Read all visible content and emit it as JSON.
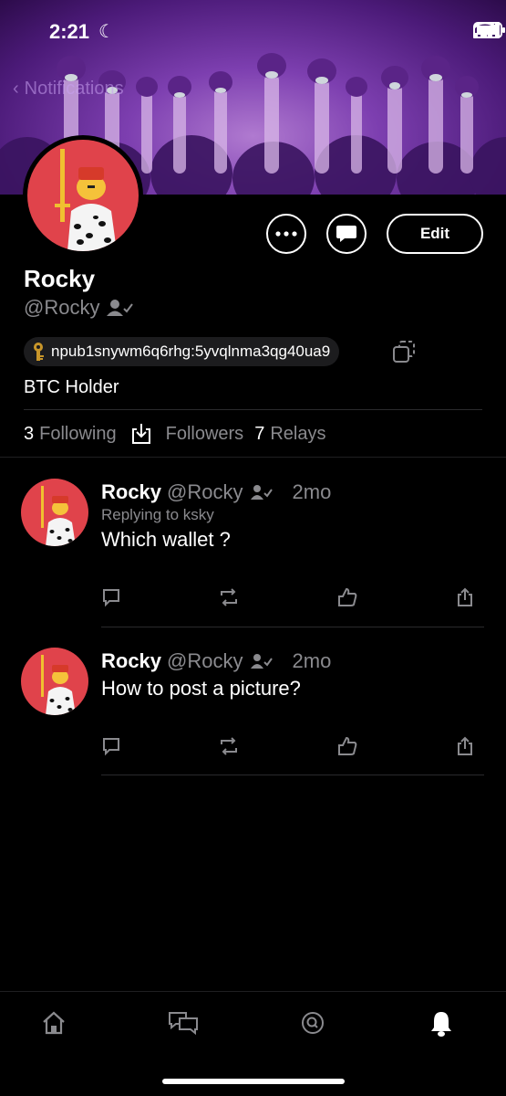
{
  "status": {
    "time": "2:21"
  },
  "header": {
    "back_label": "Notifications"
  },
  "profile": {
    "name": "Rocky",
    "handle": "@Rocky",
    "npub": "npub1snywm6q6rhg:5yvqlnma3qg40ua9",
    "bio": "BTC Holder",
    "edit_label": "Edit",
    "stats": {
      "following_count": "3",
      "following_label": "Following",
      "followers_label": "Followers",
      "relays_count": "7",
      "relays_label": "Relays"
    }
  },
  "posts": [
    {
      "name": "Rocky",
      "handle": "@Rocky",
      "time": "2mo",
      "reply_to": "Replying to ksky",
      "text": "Which wallet ?"
    },
    {
      "name": "Rocky",
      "handle": "@Rocky",
      "time": "2mo",
      "reply_to": "",
      "text": "How to post a picture?"
    }
  ],
  "colors": {
    "background": "#000000",
    "avatar_red": "#e0434b",
    "banner_purple": "#7d3fb0",
    "muted_text": "#8a8a8e"
  },
  "icons": [
    "home-icon",
    "messages-icon",
    "search-icon",
    "notifications-icon",
    "key-icon",
    "copy-icon",
    "reply-icon",
    "repost-icon",
    "like-icon",
    "share-icon"
  ]
}
